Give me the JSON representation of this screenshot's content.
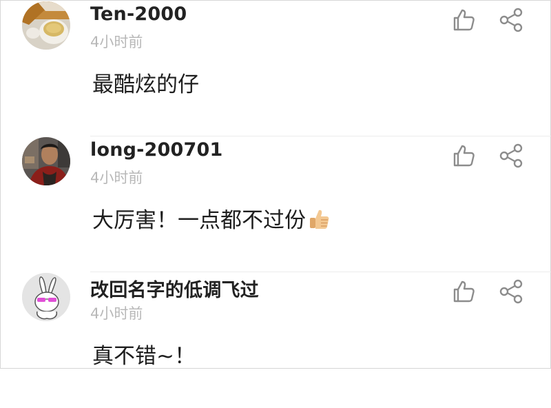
{
  "comments": [
    {
      "username": "Ten-2000",
      "time": "4小时前",
      "content": "最酷炫的仔",
      "avatar": "tea-cup-photo"
    },
    {
      "username": "long-200701",
      "time": "4小时前",
      "content": "大厉害！一点都不过份",
      "emoji": "thumbs-up-emoji",
      "avatar": "man-photo"
    },
    {
      "username": "改回名字的低调飞过",
      "time": "4小时前",
      "content": "真不错~！",
      "avatar": "rabbit-illustration"
    }
  ],
  "icons": {
    "like": "thumb-up-outline-icon",
    "share": "share-nodes-icon"
  },
  "colors": {
    "username": "#222222",
    "timestamp": "#b8b8b8",
    "content": "#1e1e1e",
    "icon": "#8c8c8c",
    "divider": "#ebebeb"
  }
}
